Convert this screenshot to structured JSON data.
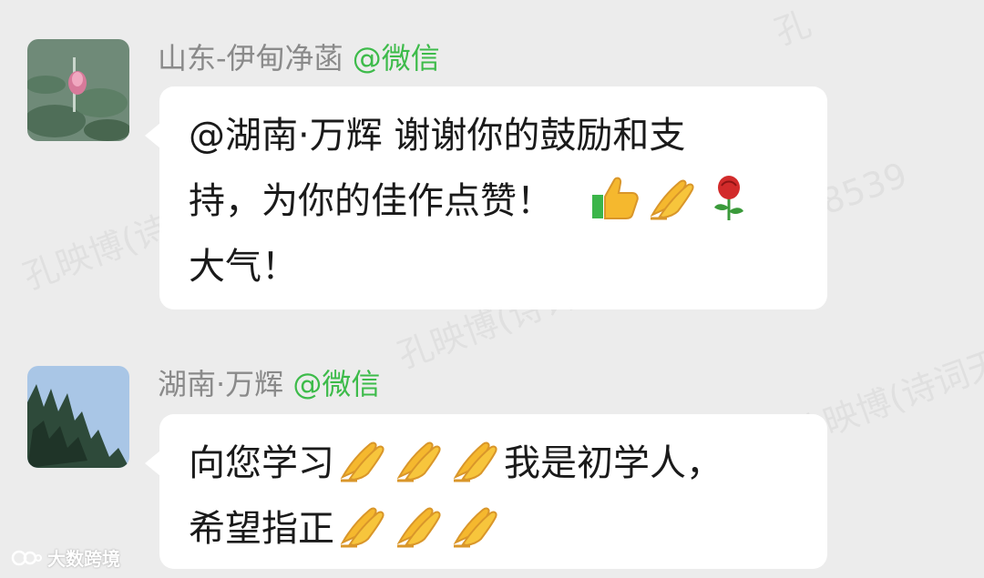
{
  "messages": [
    {
      "sender_name": "山东-伊甸净菡",
      "sender_app": "@微信",
      "lines": [
        "@湖南·万辉 谢谢你的鼓励和支",
        "持，为你的佳作点赞！",
        "大气！"
      ]
    },
    {
      "sender_name": "湖南·万辉",
      "sender_app": "@微信",
      "lines": [
        "向您学习",
        "我是初学人，",
        "希望指正"
      ]
    }
  ],
  "watermarks": [
    "孔映博(诗词",
    "孔映博(诗词天",
    "孔映博(诗词天地",
    "8539",
    "孔"
  ],
  "logo_text": "大数跨境",
  "icons": [
    "thumbs-up-icon",
    "folded-hands-icon",
    "rose-icon"
  ],
  "colors": {
    "background": "#ececec",
    "bubble": "#ffffff",
    "sender_name": "#8a8a8a",
    "app_tag": "#3dbb4a",
    "text": "#1a1a1a"
  }
}
